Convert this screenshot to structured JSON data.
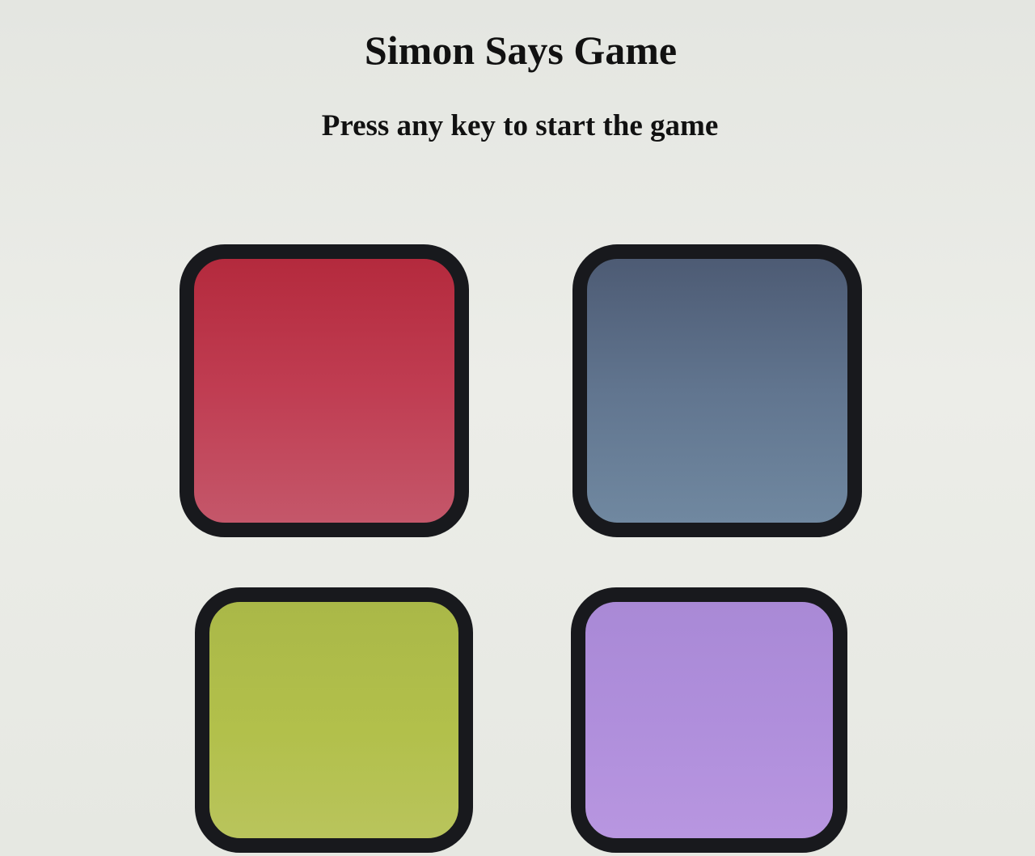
{
  "header": {
    "title": "Simon Says Game",
    "subtitle": "Press any key to start the game"
  },
  "game": {
    "buttons": [
      {
        "name": "red",
        "color": "#c03d52"
      },
      {
        "name": "blue",
        "color": "#61758f"
      },
      {
        "name": "green",
        "color": "#b2c04b"
      },
      {
        "name": "purple",
        "color": "#b08fdc"
      }
    ],
    "border_color": "#18191d"
  },
  "colors": {
    "background": "#e7e9e3",
    "text": "#111111"
  }
}
